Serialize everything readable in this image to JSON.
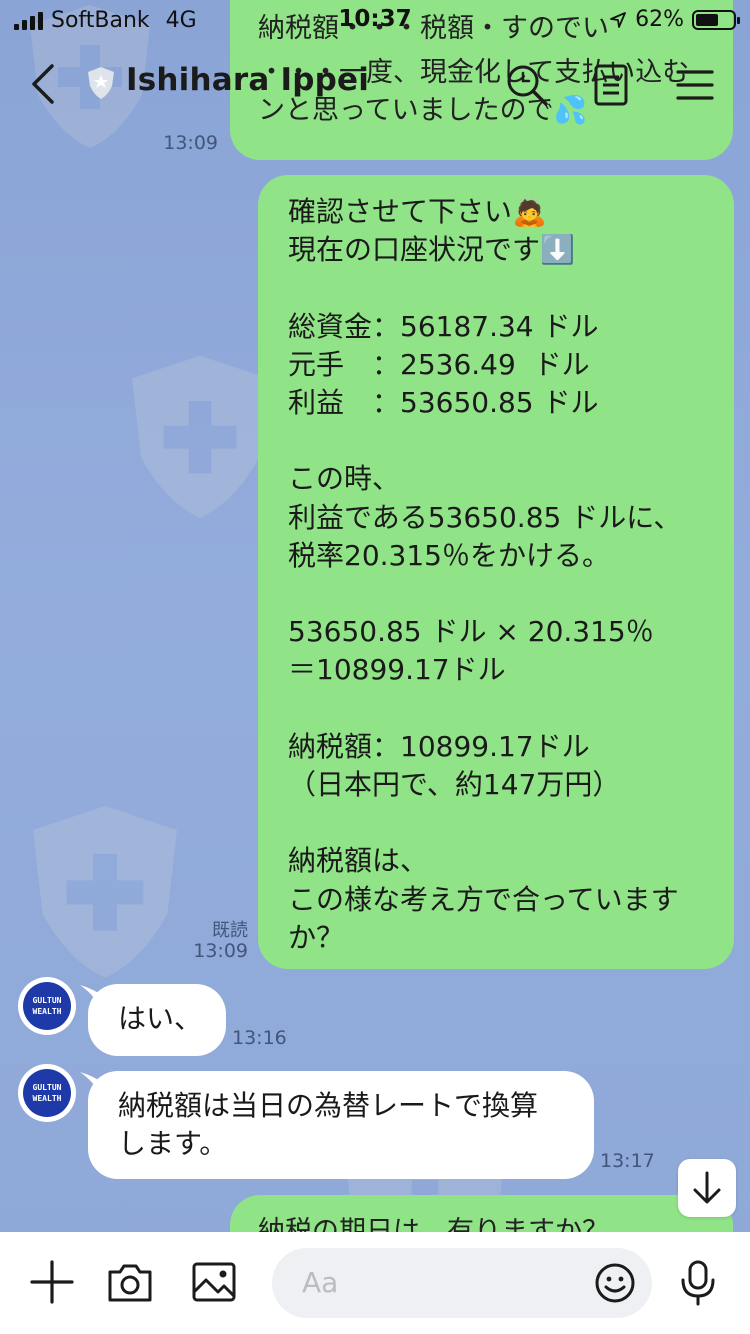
{
  "status_bar": {
    "carrier": "SoftBank",
    "network": "4G",
    "time": "10:37",
    "battery": "62%",
    "battery_level": 0.62
  },
  "nav": {
    "title": "Ishihara Ippei",
    "icons": [
      "back-chevron-icon",
      "shield-badge-icon",
      "search-icon",
      "notes-icon",
      "menu-icon"
    ]
  },
  "messages": {
    "top_partial": {
      "line1": "納税額・・・税額・すのでい",
      "line2": "・・・一度、現金化して支払い込む",
      "line3": "ンと思っていましたので💦",
      "time": "13:09"
    },
    "main": {
      "text": "確認させて下さい🙇\n現在の口座状況です⬇️\n\n総資金：56187.34 ドル\n元手　：2536.49  ドル\n利益　：53650.85 ドル\n\nこの時、\n利益である53650.85 ドルに、\n税率20.315％をかける。\n\n53650.85 ドル × 20.315％\n＝10899.17ドル\n\n納税額：10899.17ドル\n（日本円で、約147万円）\n\n納税額は、\nこの様な考え方で合っています\nか？",
      "read_label": "既読",
      "time": "13:09"
    },
    "reply1": {
      "text": "はい、",
      "time": "13:16"
    },
    "reply2": {
      "text": "納税額は当日の為替レートで換算\nします。",
      "time": "13:17"
    },
    "bottom_partial": {
      "text": "納税の期日は、有りますか？"
    },
    "avatar_logo": [
      "GULTUN",
      "WEALTH"
    ]
  },
  "input_bar": {
    "placeholder": "Aa",
    "icons": [
      "plus-icon",
      "camera-icon",
      "image-icon",
      "emoji-icon",
      "microphone-icon"
    ]
  },
  "colors": {
    "background": "#8fa7d8",
    "my_bubble": "#90e386",
    "their_bubble": "#ffffff",
    "avatar": "#1d3aa8"
  }
}
